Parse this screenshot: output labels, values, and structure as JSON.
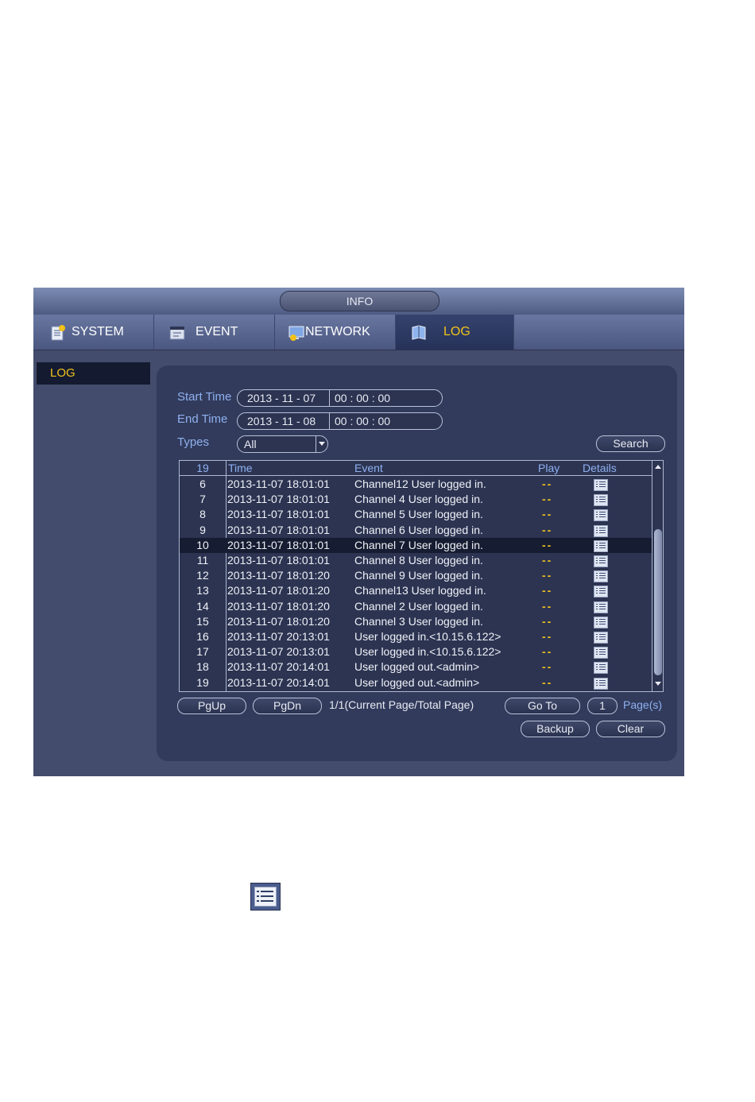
{
  "window": {
    "title": "INFO"
  },
  "tabs": [
    {
      "label": "SYSTEM",
      "icon": "system-icon"
    },
    {
      "label": "EVENT",
      "icon": "event-icon"
    },
    {
      "label": "NETWORK",
      "icon": "network-icon"
    },
    {
      "label": "LOG",
      "icon": "log-icon",
      "active": true
    }
  ],
  "sidebar": {
    "items": [
      {
        "label": "LOG",
        "active": true
      }
    ]
  },
  "filters": {
    "start_label": "Start Time",
    "start_date": "2013 - 11 - 07",
    "start_time": "00 :  00 :  00",
    "end_label": "End Time",
    "end_date": "2013 - 11 - 08",
    "end_time": "00 :  00 :  00",
    "types_label": "Types",
    "types_value": "All",
    "search_label": "Search"
  },
  "table": {
    "headers": {
      "count": "19",
      "time": "Time",
      "event": "Event",
      "play": "Play",
      "details": "Details"
    },
    "rows": [
      {
        "num": "6",
        "time": "2013-11-07 18:01:01",
        "event": "Channel12  User logged in.",
        "play": "--"
      },
      {
        "num": "7",
        "time": "2013-11-07 18:01:01",
        "event": "Channel 4  User logged in.",
        "play": "--"
      },
      {
        "num": "8",
        "time": "2013-11-07 18:01:01",
        "event": "Channel 5  User logged in.",
        "play": "--"
      },
      {
        "num": "9",
        "time": "2013-11-07 18:01:01",
        "event": "Channel 6  User logged in.",
        "play": "--"
      },
      {
        "num": "10",
        "time": "2013-11-07 18:01:01",
        "event": "Channel 7  User logged in.",
        "play": "--",
        "selected": true
      },
      {
        "num": "11",
        "time": "2013-11-07 18:01:01",
        "event": "Channel 8  User logged in.",
        "play": "--"
      },
      {
        "num": "12",
        "time": "2013-11-07 18:01:20",
        "event": "Channel 9  User logged in.",
        "play": "--"
      },
      {
        "num": "13",
        "time": "2013-11-07 18:01:20",
        "event": "Channel13  User logged in.",
        "play": "--"
      },
      {
        "num": "14",
        "time": "2013-11-07 18:01:20",
        "event": "Channel 2  User logged in.",
        "play": "--"
      },
      {
        "num": "15",
        "time": "2013-11-07 18:01:20",
        "event": "Channel 3  User logged in.",
        "play": "--"
      },
      {
        "num": "16",
        "time": "2013-11-07 20:13:01",
        "event": "User logged in.<10.15.6.122>",
        "play": "--"
      },
      {
        "num": "17",
        "time": "2013-11-07 20:13:01",
        "event": "User logged in.<10.15.6.122>",
        "play": "--"
      },
      {
        "num": "18",
        "time": "2013-11-07 20:14:01",
        "event": "User logged out.<admin>",
        "play": "--"
      },
      {
        "num": "19",
        "time": "2013-11-07 20:14:01",
        "event": "User logged out.<admin>",
        "play": "--"
      }
    ]
  },
  "pager": {
    "pgup": "PgUp",
    "pgdn": "PgDn",
    "info": "1/1(Current Page/Total Page)",
    "goto": "Go To",
    "page_input": "1",
    "pages_label": "Page(s)"
  },
  "actions": {
    "backup": "Backup",
    "clear": "Clear"
  },
  "colors": {
    "accent": "#f2c21b",
    "label": "#8fb0ef",
    "background": "#434c6c"
  }
}
